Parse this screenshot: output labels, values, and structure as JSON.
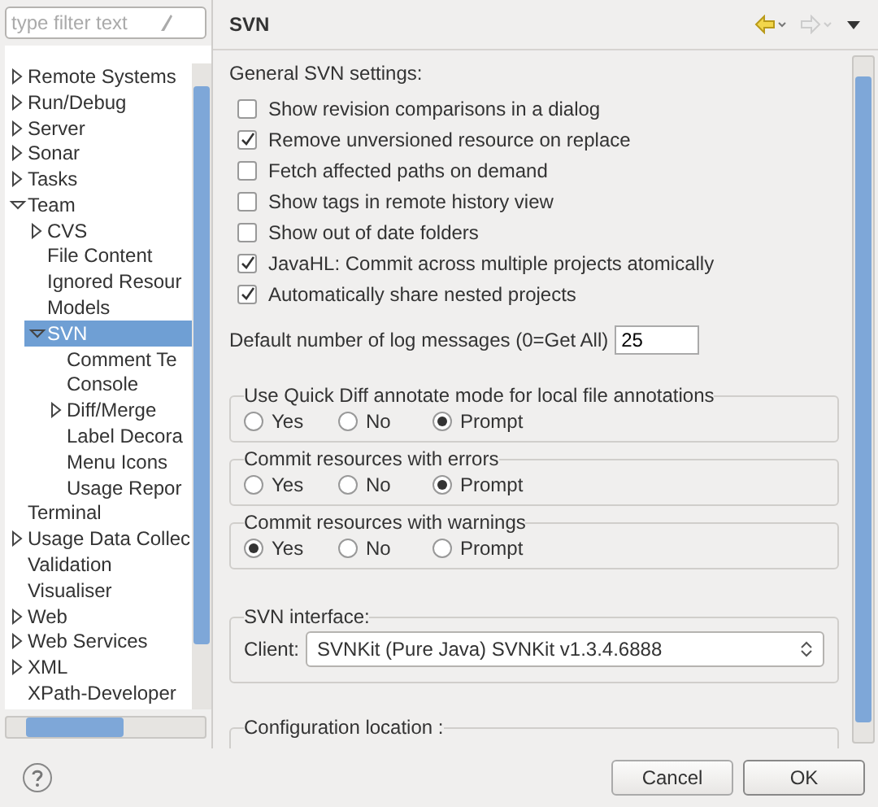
{
  "filter": {
    "placeholder": "type filter text"
  },
  "tree": [
    {
      "label": "Remote Systems",
      "expanded": false,
      "selected": false
    },
    {
      "label": "Run/Debug",
      "expanded": false,
      "selected": false
    },
    {
      "label": "Server",
      "expanded": false,
      "selected": false
    },
    {
      "label": "Sonar",
      "expanded": false,
      "selected": false
    },
    {
      "label": "Tasks",
      "expanded": false,
      "selected": false
    },
    {
      "label": "Team",
      "expanded": true,
      "selected": false,
      "children": [
        {
          "label": "CVS",
          "expanded": false,
          "selected": false
        },
        {
          "label": "File Content",
          "selected": false
        },
        {
          "label": "Ignored Resour",
          "selected": false
        },
        {
          "label": "Models",
          "selected": false
        },
        {
          "label": "SVN",
          "expanded": true,
          "selected": true,
          "children": [
            {
              "label": "Comment Te",
              "selected": false
            },
            {
              "label": "Console",
              "selected": false
            },
            {
              "label": "Diff/Merge",
              "expanded": false,
              "selected": false
            },
            {
              "label": "Label Decora",
              "selected": false
            },
            {
              "label": "Menu Icons",
              "selected": false
            },
            {
              "label": "Usage Repor",
              "selected": false
            }
          ]
        }
      ]
    },
    {
      "label": "Terminal",
      "selected": false
    },
    {
      "label": "Usage Data Collec",
      "expanded": false,
      "selected": false
    },
    {
      "label": "Validation",
      "selected": false
    },
    {
      "label": "Visualiser",
      "selected": false
    },
    {
      "label": "Web",
      "expanded": false,
      "selected": false
    },
    {
      "label": "Web Services",
      "expanded": false,
      "selected": false
    },
    {
      "label": "XML",
      "expanded": false,
      "selected": false
    },
    {
      "label": "XPath-Developer",
      "selected": false
    }
  ],
  "page": {
    "title": "SVN",
    "section_label": "General SVN settings:",
    "options": [
      {
        "label": "Show revision comparisons in a dialog",
        "checked": false
      },
      {
        "label": "Remove unversioned resource on replace",
        "checked": true
      },
      {
        "label": "Fetch affected paths on demand",
        "checked": false
      },
      {
        "label": "Show tags in remote history view",
        "checked": false
      },
      {
        "label": "Show out of date folders",
        "checked": false
      },
      {
        "label": "JavaHL: Commit across multiple projects atomically",
        "checked": true
      },
      {
        "label": "Automatically share nested projects",
        "checked": true
      }
    ],
    "log_messages": {
      "label": "Default number of log messages (0=Get All)",
      "value": "25"
    },
    "radio_groups": [
      {
        "title": "Use Quick Diff annotate mode for local file annotations",
        "options": [
          {
            "label": "Yes",
            "selected": false
          },
          {
            "label": "No",
            "selected": false
          },
          {
            "label": "Prompt",
            "selected": true
          }
        ]
      },
      {
        "title": "Commit resources with errors",
        "options": [
          {
            "label": "Yes",
            "selected": false
          },
          {
            "label": "No",
            "selected": false
          },
          {
            "label": "Prompt",
            "selected": true
          }
        ]
      },
      {
        "title": "Commit resources with warnings",
        "options": [
          {
            "label": "Yes",
            "selected": true
          },
          {
            "label": "No",
            "selected": false
          },
          {
            "label": "Prompt",
            "selected": false
          }
        ]
      }
    ],
    "interface": {
      "title": "SVN interface:",
      "client_label": "Client:",
      "client_value": "SVNKit (Pure Java) SVNKit v1.3.4.6888"
    },
    "config": {
      "title": "Configuration location :"
    }
  },
  "buttons": [
    "Cancel",
    "OK"
  ]
}
